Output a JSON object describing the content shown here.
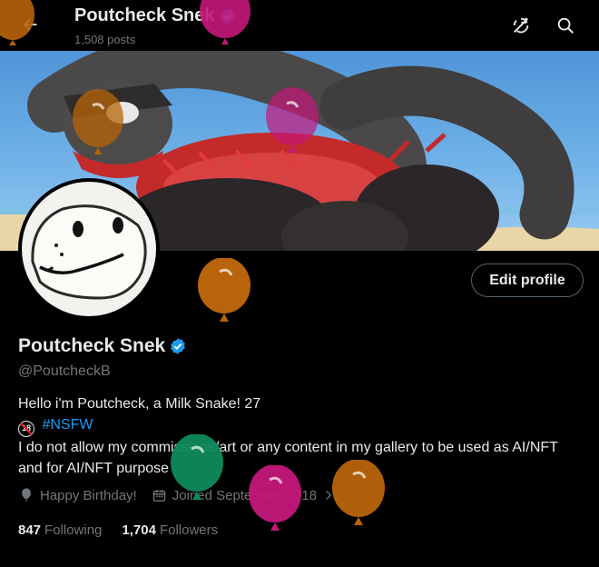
{
  "header": {
    "title": "Poutcheck Snek",
    "post_count": "1,508 posts",
    "icons": [
      "back-arrow-icon",
      "verified-badge-icon",
      "sync-off-icon",
      "search-icon"
    ]
  },
  "profile": {
    "display_name": "Poutcheck Snek",
    "handle": "@PoutcheckB",
    "edit_label": "Edit profile",
    "bio_line1": "Hello i'm Poutcheck, a Milk Snake! 27",
    "adult_badge": "18",
    "hashtag": "#NSFW",
    "bio_line3": "I do not allow my commissions/art or any content in my gallery to be used as AI/NFT and for AI/NFT purpose",
    "birthday": "Happy Birthday!",
    "joined": "Joined September 2018",
    "following_count": "847",
    "following_label": "Following",
    "followers_count": "1,704",
    "followers_label": "Followers"
  },
  "colors": {
    "background": "#000000",
    "text": "#e7e9ea",
    "muted": "#71767b",
    "link": "#1d9bf0",
    "verified": "#1d9bf0",
    "balloon_orange": "#b8640a",
    "balloon_pink": "#c4177a",
    "balloon_green": "#0e8a5c"
  }
}
